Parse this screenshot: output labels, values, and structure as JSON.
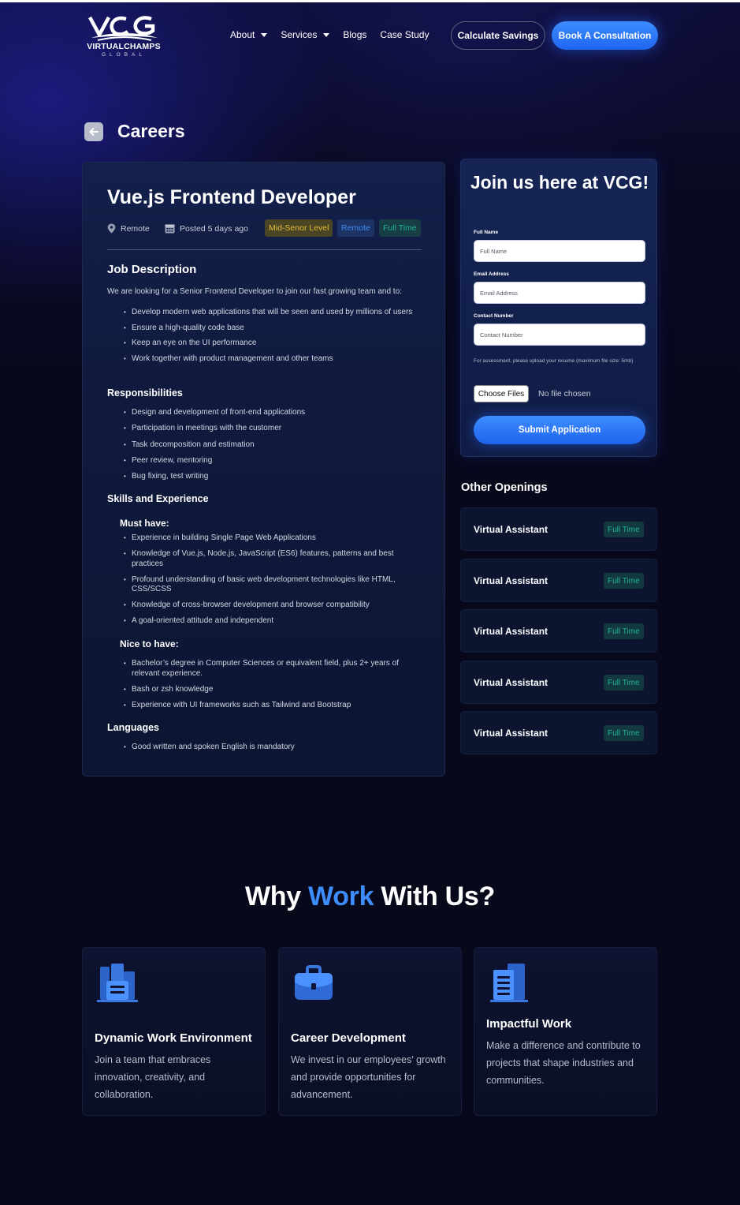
{
  "nav": {
    "logo_text": "VIRTUALCHAMPS",
    "logo_sub": "GLOBAL",
    "links": [
      {
        "label": "About",
        "dropdown": true
      },
      {
        "label": "Services",
        "dropdown": true
      },
      {
        "label": "Blogs",
        "dropdown": false
      },
      {
        "label": "Case Study",
        "dropdown": false
      }
    ],
    "calc_label": "Calculate Savings",
    "book_label": "Book A Consultation"
  },
  "page": {
    "title": "Careers"
  },
  "job": {
    "title": "Vue.js Frontend Developer",
    "location": "Remote",
    "posted": "Posted 5 days ago",
    "badges": {
      "level": "Mid-Senor Level",
      "remote": "Remote",
      "type": "Full Time"
    },
    "description_heading": "Job Description",
    "description_intro": "We are looking for a Senior Frontend Developer to join our fast growing team and to:",
    "description_items": [
      "Develop modern web applications that will be seen and used by millions of users",
      "Ensure a high-quality code base",
      "Keep an eye on the UI performance",
      "Work together with product management and other teams"
    ],
    "responsibilities_heading": "Responsibilities",
    "responsibilities": [
      "Design and development of front-end applications",
      "Participation in meetings with the customer",
      "Task decomposition and estimation",
      "Peer review, mentoring",
      "Bug fixing, test writing"
    ],
    "skills_heading": "Skills and Experience",
    "must_heading": "Must have:",
    "must_have": [
      "Experience in building Single Page Web Applications",
      "Knowledge of Vue.js, Node.js, JavaScript (ES6) features, patterns and best practices",
      "Profound understanding of basic web development technologies like HTML, CSS/SCSS",
      "Knowledge of cross-browser development and browser compatibility",
      "A goal-oriented attitude and independent"
    ],
    "nice_heading": "Nice to have:",
    "nice_to_have": [
      "Bachelor’s degree in Computer Sciences or equivalent field, plus 2+ years of relevant experience.",
      "Bash or zsh knowledge",
      "Experience with UI frameworks such as Tailwind and Bootstrap"
    ],
    "languages_heading": "Languages",
    "languages": [
      "Good written and spoken English is mandatory"
    ]
  },
  "form": {
    "title": "Join us here at VCG!",
    "full_name_label": "Full Name",
    "full_name_placeholder": "Full Name",
    "email_label": "Email Address",
    "email_placeholder": "Email Address",
    "phone_label": "Contact Number",
    "phone_placeholder": "Contact Number",
    "note": "For assessment, please upload your resume (maximum file size: 5mb)",
    "file_button": "Choose Files",
    "file_status": "No file chosen",
    "submit_label": "Submit Application"
  },
  "openings": {
    "title": "Other Openings",
    "items": [
      {
        "name": "Virtual Assistant",
        "type": "Full Time"
      },
      {
        "name": "Virtual Assistant",
        "type": "Full Time"
      },
      {
        "name": "Virtual Assistant",
        "type": "Full Time"
      },
      {
        "name": "Virtual Assistant",
        "type": "Full Time"
      },
      {
        "name": "Virtual Assistant",
        "type": "Full Time"
      }
    ]
  },
  "why": {
    "title_before": "Why ",
    "title_accent": "Work",
    "title_after": " With Us?",
    "features": [
      {
        "icon": "building-icon",
        "title": "Dynamic Work Environment",
        "desc": "Join a team that embraces innovation, creativity, and collaboration."
      },
      {
        "icon": "briefcase-icon",
        "title": "Career Development",
        "desc": "We invest in our employees' growth and provide opportunities for advancement."
      },
      {
        "icon": "office-tower-icon",
        "title": "Impactful Work",
        "desc": "Make a difference and contribute to projects that shape industries and communities."
      }
    ]
  },
  "colors": {
    "accent": "#3d8dff",
    "level_badge": "#e3bc35",
    "remote_badge": "#3b8cf3",
    "fulltime_badge": "#1fb49a"
  }
}
